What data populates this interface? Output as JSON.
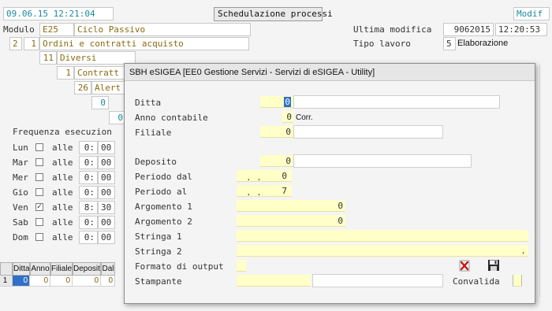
{
  "header": {
    "datetime": "09.06.15 12:21:04",
    "title": "Schedulazione processi",
    "mode": "Modif",
    "modulo_label": "Modulo",
    "modulo_code": "E25",
    "modulo_name": "Ciclo Passivo",
    "ultima_modifica_label": "Ultima modifica",
    "ultima_modifica_date": "9062015",
    "ultima_modifica_time": "12:20:53",
    "tipo_lavoro_label": "Tipo lavoro",
    "tipo_lavoro_code": "5",
    "tipo_lavoro_name": "Elaborazione"
  },
  "tree": {
    "l1_a": "2",
    "l1_b": "1",
    "l1_name": "Ordini e contratti acquisto",
    "l2_num": "11",
    "l2_name": "Diversi",
    "l3_num": "1",
    "l3_name": "Contratt",
    "l4_num": "26",
    "l4_name": "Alert",
    "val_a": "0",
    "val_b": "0"
  },
  "frequenza": {
    "label": "Frequenza esecuzion",
    "alle": "alle",
    "days": [
      {
        "day": "Lun",
        "checked": false,
        "hour": "0:",
        "min": "00"
      },
      {
        "day": "Mar",
        "checked": false,
        "hour": "0:",
        "min": "00"
      },
      {
        "day": "Mer",
        "checked": false,
        "hour": "0:",
        "min": "00"
      },
      {
        "day": "Gio",
        "checked": false,
        "hour": "0:",
        "min": "00"
      },
      {
        "day": "Ven",
        "checked": true,
        "hour": "8:",
        "min": "30"
      },
      {
        "day": "Sab",
        "checked": false,
        "hour": "0:",
        "min": "00"
      },
      {
        "day": "Dom",
        "checked": false,
        "hour": "0:",
        "min": "00"
      }
    ]
  },
  "grid": {
    "headers": [
      "Ditta",
      "Anno",
      "Filiale",
      "Deposito",
      "Dal"
    ],
    "row_num": "1",
    "values": [
      "0",
      "0",
      "0",
      "0",
      "0"
    ]
  },
  "dialog": {
    "title": "SBH eSIGEA [EE0 Gestione Servizi - Servizi di eSIGEA - Utility]",
    "ditta_label": "Ditta",
    "ditta_value": "0",
    "anno_label": "Anno contabile",
    "anno_value": "0",
    "anno_suffix": "Corr.",
    "filiale_label": "Filiale",
    "filiale_value": "0",
    "deposito_label": "Deposito",
    "deposito_value": "0",
    "periodo_dal_label": "Periodo dal",
    "periodo_dal_dots": ". .",
    "periodo_dal_value": "0",
    "periodo_al_label": "Periodo  al",
    "periodo_al_dots": ". .",
    "periodo_al_value": "7",
    "argomento1_label": "Argomento 1",
    "argomento1_value": "0",
    "argomento2_label": "Argomento 2",
    "argomento2_value": "0",
    "stringa1_label": "Stringa  1",
    "stringa2_label": "Stringa  2",
    "stringa2_value": ".",
    "formato_label": "Formato di output",
    "stampante_label": "Stampante",
    "convalida_label": "Convalida"
  },
  "icons": {
    "cancel": "cancel-icon",
    "save": "save-icon"
  }
}
